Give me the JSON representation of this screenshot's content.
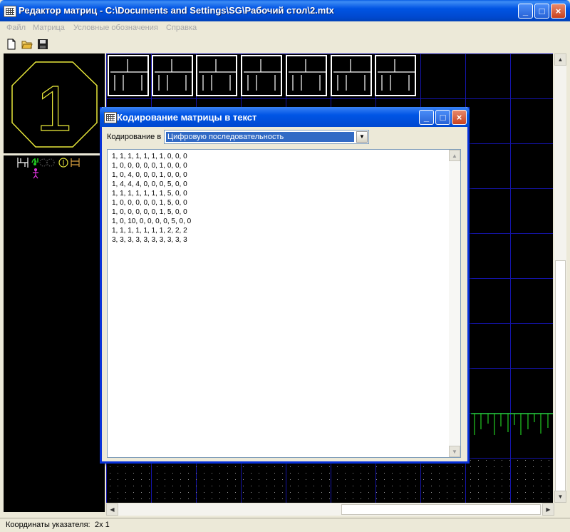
{
  "app": {
    "title": "Редактор матриц - C:\\Documents and Settings\\SG\\Рабочий стол\\2.mtx",
    "window_controls": {
      "minimize": "_",
      "maximize": "□",
      "close": "×"
    }
  },
  "menu": [
    "Файл",
    "Матрица",
    "Условные обозначения",
    "Справка"
  ],
  "toolbar": {
    "icons": [
      "new-file-icon",
      "open-folder-icon",
      "save-disk-icon"
    ]
  },
  "preview": {
    "digit": "1"
  },
  "dialog": {
    "title": "Кодирование матрицы в текст",
    "encoding_label": "Кодирование в",
    "encoding_value": "Цифровую последовательность",
    "output_text": "1, 1, 1, 1, 1, 1, 1, 0, 0, 0\n1, 0, 0, 0, 0, 0, 1, 0, 0, 0\n1, 0, 4, 0, 0, 0, 1, 0, 0, 0\n1, 4, 4, 4, 0, 0, 0, 5, 0, 0\n1, 1, 1, 1, 1, 1, 1, 5, 0, 0\n1, 0, 0, 0, 0, 0, 1, 5, 0, 0\n1, 0, 0, 0, 0, 0, 1, 5, 0, 0\n1, 0, 10, 0, 0, 0, 0, 5, 0, 0\n1, 1, 1, 1, 1, 1, 1, 2, 2, 2\n3, 3, 3, 3, 3, 3, 3, 3, 3, 3"
  },
  "status": {
    "label": "Координаты указателя:",
    "value": "2x 1"
  },
  "colors": {
    "titlebar": "#0054e3",
    "grid": "#1414a8",
    "preview_outline": "#e8e83a",
    "grass": "#22cc22",
    "selection": "#316ac5"
  }
}
